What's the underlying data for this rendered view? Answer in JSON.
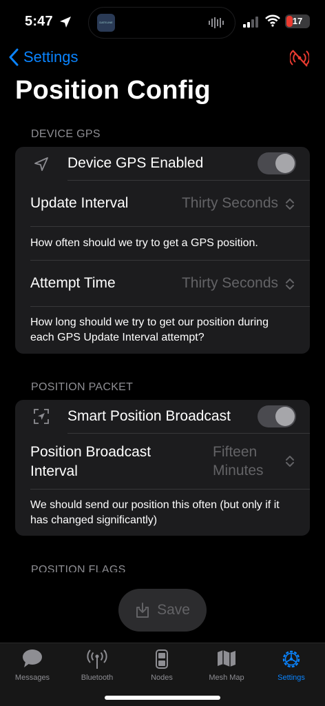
{
  "status_bar": {
    "time": "5:47",
    "battery": "17",
    "island_thumb_text": "DATELINE"
  },
  "nav": {
    "back_label": "Settings",
    "title": "Position Config"
  },
  "device_gps": {
    "header": "DEVICE GPS",
    "enabled_label": "Device GPS Enabled",
    "update_interval_label": "Update Interval",
    "update_interval_value": "Thirty Seconds",
    "update_interval_desc": "How often should we try to get a GPS position.",
    "attempt_time_label": "Attempt Time",
    "attempt_time_value": "Thirty Seconds",
    "attempt_time_desc": "How long should we try to get our position during each GPS Update Interval attempt?"
  },
  "position_packet": {
    "header": "POSITION PACKET",
    "smart_label": "Smart Position Broadcast",
    "broadcast_interval_label": "Position Broadcast Interval",
    "broadcast_interval_value": "Fifteen Minutes",
    "broadcast_interval_desc": "We should send our position this often (but only if it has changed significantly)"
  },
  "position_flags": {
    "header": "POSITION FLAGS"
  },
  "save_label": "Save",
  "tabs": [
    {
      "label": "Messages",
      "icon": "chat-bubble-icon"
    },
    {
      "label": "Bluetooth",
      "icon": "antenna-icon"
    },
    {
      "label": "Nodes",
      "icon": "radio-device-icon"
    },
    {
      "label": "Mesh Map",
      "icon": "map-icon"
    },
    {
      "label": "Settings",
      "icon": "gear-icon"
    }
  ],
  "colors": {
    "accent": "#0a84ff",
    "background": "#000000",
    "card": "#1c1c1e",
    "disconnected": "#eb3b30"
  }
}
